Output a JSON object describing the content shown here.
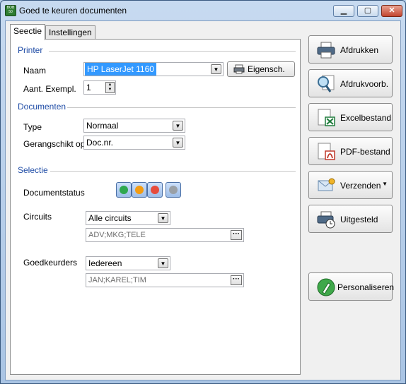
{
  "window": {
    "title": "Goed te keuren documenten",
    "icon_text": "BOB 50",
    "minimize_glyph": "▁",
    "maximize_glyph": "▢",
    "close_glyph": "✕"
  },
  "tabs": [
    {
      "label": "Seectie",
      "active": true
    },
    {
      "label": "Instellingen",
      "active": false
    }
  ],
  "printer": {
    "heading": "Printer",
    "name_label": "Naam",
    "name_value": "HP LaserJet 1160",
    "properties_button": "Eigensch.",
    "copies_label": "Aant. Exempl.",
    "copies_value": "1"
  },
  "documents": {
    "heading": "Documenten",
    "type_label": "Type",
    "type_value": "Normaal",
    "sort_label": "Gerangschikt op",
    "sort_value": "Doc.nr."
  },
  "selection": {
    "heading": "Selectie",
    "status_label": "Documentstatus",
    "status_colors": [
      "#2fa84f",
      "#f39c12",
      "#e74c3c",
      "#9aa0a6"
    ],
    "circuits_label": "Circuits",
    "circuits_value": "Alle circuits",
    "circuits_list": "ADV;MKG;TELE",
    "approvers_label": "Goedkeurders",
    "approvers_value": "Iedereen",
    "approvers_list": "JAN;KAREL;TIM",
    "ellipsis": "···"
  },
  "actions": {
    "print": "Afdrukken",
    "preview": "Afdrukvoorb.",
    "excel": "Excelbestand",
    "pdf": "PDF-bestand",
    "send": "Verzenden",
    "deferred": "Uitgesteld",
    "personalize": "Personaliseren"
  },
  "colors": {
    "accent_heading": "#1f4ca6",
    "selection_highlight": "#3399ff"
  }
}
